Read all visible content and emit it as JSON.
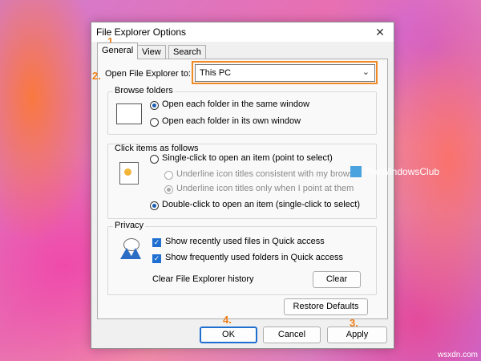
{
  "dialog": {
    "title": "File Explorer Options",
    "close_glyph": "✕",
    "tabs": [
      "General",
      "View",
      "Search"
    ],
    "open_to_label": "Open File Explorer to:",
    "open_to_value": "This PC",
    "browse": {
      "title": "Browse folders",
      "options": [
        "Open each folder in the same window",
        "Open each folder in its own window"
      ],
      "selected": 0
    },
    "click": {
      "title": "Click items as follows",
      "options": [
        "Single-click to open an item (point to select)",
        "Underline icon titles consistent with my browser",
        "Underline icon titles only when I point at them",
        "Double-click to open an item (single-click to select)"
      ],
      "selected": 3
    },
    "privacy": {
      "title": "Privacy",
      "checks": [
        "Show recently used files in Quick access",
        "Show frequently used folders in Quick access"
      ],
      "clear_label": "Clear File Explorer history",
      "clear_button": "Clear"
    },
    "restore_button": "Restore Defaults",
    "ok_button": "OK",
    "cancel_button": "Cancel",
    "apply_button": "Apply"
  },
  "steps": [
    "1.",
    "2.",
    "3.",
    "4."
  ],
  "watermark": "TheWindowsClub",
  "site": "wsxdn.com",
  "colors": {
    "step": "#f07f16",
    "accent": "#1f6fd1"
  }
}
